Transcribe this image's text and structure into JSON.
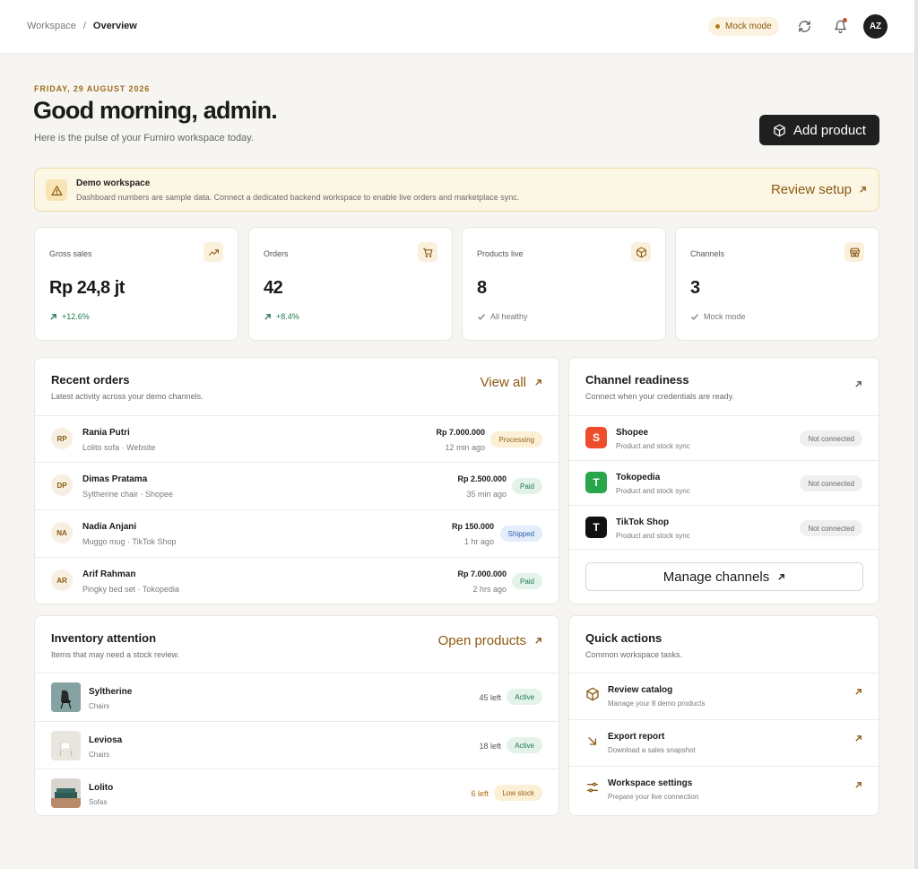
{
  "breadcrumb": {
    "root": "Workspace",
    "separator": "/",
    "current": "Overview"
  },
  "topbar": {
    "mock_mode": "Mock mode",
    "avatar_initials": "AZ"
  },
  "greeting": {
    "date": "FRIDAY, 29 AUGUST 2026",
    "title": "Good morning, admin.",
    "subtitle": "Here is the pulse of your Furniro workspace today.",
    "add_product": "Add product"
  },
  "banner": {
    "title": "Demo workspace",
    "text": "Dashboard numbers are sample data. Connect a dedicated backend workspace to enable live orders and marketplace sync.",
    "link": "Review setup"
  },
  "stats": [
    {
      "label": "Gross sales",
      "value": "Rp 24,8 jt",
      "foot": "+12.6%",
      "icon": "trend-up-icon",
      "trend": "up"
    },
    {
      "label": "Orders",
      "value": "42",
      "foot": "+8.4%",
      "icon": "cart-icon",
      "trend": "up"
    },
    {
      "label": "Products live",
      "value": "8",
      "foot": "All healthy",
      "icon": "box-icon",
      "trend": "check"
    },
    {
      "label": "Channels",
      "value": "3",
      "foot": "Mock mode",
      "icon": "store-icon",
      "trend": "check"
    }
  ],
  "recent_orders": {
    "title": "Recent orders",
    "subtitle": "Latest activity across your demo channels.",
    "link": "View all",
    "rows": [
      {
        "initials": "RP",
        "name": "Rania Putri",
        "meta": "Lolito sofa · Website",
        "amount": "Rp 7.000.000",
        "time": "12 min ago",
        "status": "Processing",
        "status_kind": "proc"
      },
      {
        "initials": "DP",
        "name": "Dimas Pratama",
        "meta": "Syltherine chair · Shopee",
        "amount": "Rp 2.500.000",
        "time": "35 min ago",
        "status": "Paid",
        "status_kind": "paid"
      },
      {
        "initials": "NA",
        "name": "Nadia Anjani",
        "meta": "Muggo mug · TikTok Shop",
        "amount": "Rp 150.000",
        "time": "1 hr ago",
        "status": "Shipped",
        "status_kind": "ship"
      },
      {
        "initials": "AR",
        "name": "Arif Rahman",
        "meta": "Pingky bed set · Tokopedia",
        "amount": "Rp 7.000.000",
        "time": "2 hrs ago",
        "status": "Paid",
        "status_kind": "paid"
      }
    ]
  },
  "channels": {
    "title": "Channel readiness",
    "subtitle": "Connect when your credentials are ready.",
    "rows": [
      {
        "letter": "S",
        "name": "Shopee",
        "meta": "Product and stock sync",
        "status": "Not connected",
        "color": "#ee4d2d"
      },
      {
        "letter": "T",
        "name": "Tokopedia",
        "meta": "Product and stock sync",
        "status": "Not connected",
        "color": "#2aa64a"
      },
      {
        "letter": "T",
        "name": "TikTok Shop",
        "meta": "Product and stock sync",
        "status": "Not connected",
        "color": "#111111"
      }
    ],
    "manage": "Manage channels"
  },
  "inventory": {
    "title": "Inventory attention",
    "subtitle": "Items that may need a stock review.",
    "link": "Open products",
    "rows": [
      {
        "name": "Syltherine",
        "meta": "Chairs",
        "left": "45 left",
        "status": "Active",
        "status_kind": "active"
      },
      {
        "name": "Leviosa",
        "meta": "Chairs",
        "left": "18 left",
        "status": "Active",
        "status_kind": "active"
      },
      {
        "name": "Lolito",
        "meta": "Sofas",
        "left": "6 left",
        "status": "Low stock",
        "status_kind": "low"
      }
    ]
  },
  "quick_actions": {
    "title": "Quick actions",
    "subtitle": "Common workspace tasks.",
    "rows": [
      {
        "name": "Review catalog",
        "meta": "Manage your 8 demo products",
        "icon": "box-icon"
      },
      {
        "name": "Export report",
        "meta": "Download a sales snapshot",
        "icon": "arrow-down-right-icon"
      },
      {
        "name": "Workspace settings",
        "meta": "Prepare your live connection",
        "icon": "sliders-icon"
      }
    ]
  },
  "colors": {
    "accent": "#8a5a12",
    "dark": "#1f1f1f",
    "background": "#f6f5f1"
  }
}
